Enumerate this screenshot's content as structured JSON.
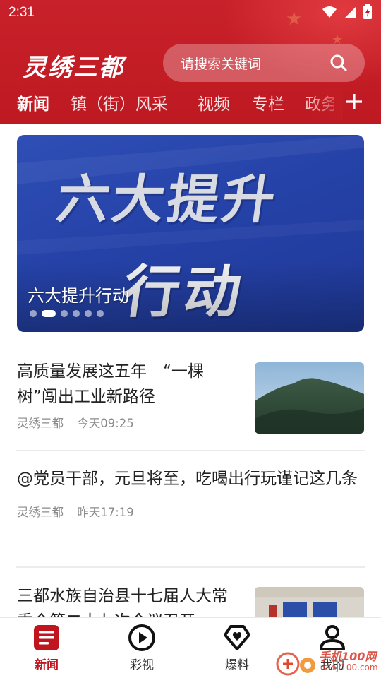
{
  "status_bar": {
    "time": "2:31"
  },
  "header": {
    "brand": "灵绣三都",
    "search_placeholder": "请搜索关键词",
    "tabs": [
      {
        "label": "新闻",
        "active": true
      },
      {
        "label": "镇（街）风采",
        "active": false
      },
      {
        "label": "视频",
        "active": false
      },
      {
        "label": "专栏",
        "active": false
      },
      {
        "label": "政务",
        "active": false
      }
    ],
    "accent_color": "#c21c25"
  },
  "banner": {
    "headline_line1": "六大提升",
    "headline_line2": "行动",
    "caption": "六大提升行动",
    "slide_count": 6,
    "active_slide": 2
  },
  "news": [
    {
      "title": "高质量发展这五年｜“一棵树”闯出工业新路径",
      "source": "灵绣三都",
      "time": "今天09:25",
      "has_image": true
    },
    {
      "title": "@党员干部，元旦将至，吃喝出行玩谨记这几条",
      "source": "灵绣三都",
      "time": "昨天17:19",
      "has_image": false
    },
    {
      "title": "三都水族自治县十七届人大常委会第二十七次会议召开",
      "source": "",
      "time": "",
      "has_image": true
    }
  ],
  "bottom_nav": [
    {
      "label": "新闻",
      "icon": "news-icon",
      "active": true
    },
    {
      "label": "彩视",
      "icon": "play-circle-icon",
      "active": false
    },
    {
      "label": "爆料",
      "icon": "heart-diamond-icon",
      "active": false
    },
    {
      "label": "我的",
      "icon": "user-icon",
      "active": false
    }
  ],
  "watermark": {
    "text": "手机100网",
    "sub": "danji100.com"
  }
}
